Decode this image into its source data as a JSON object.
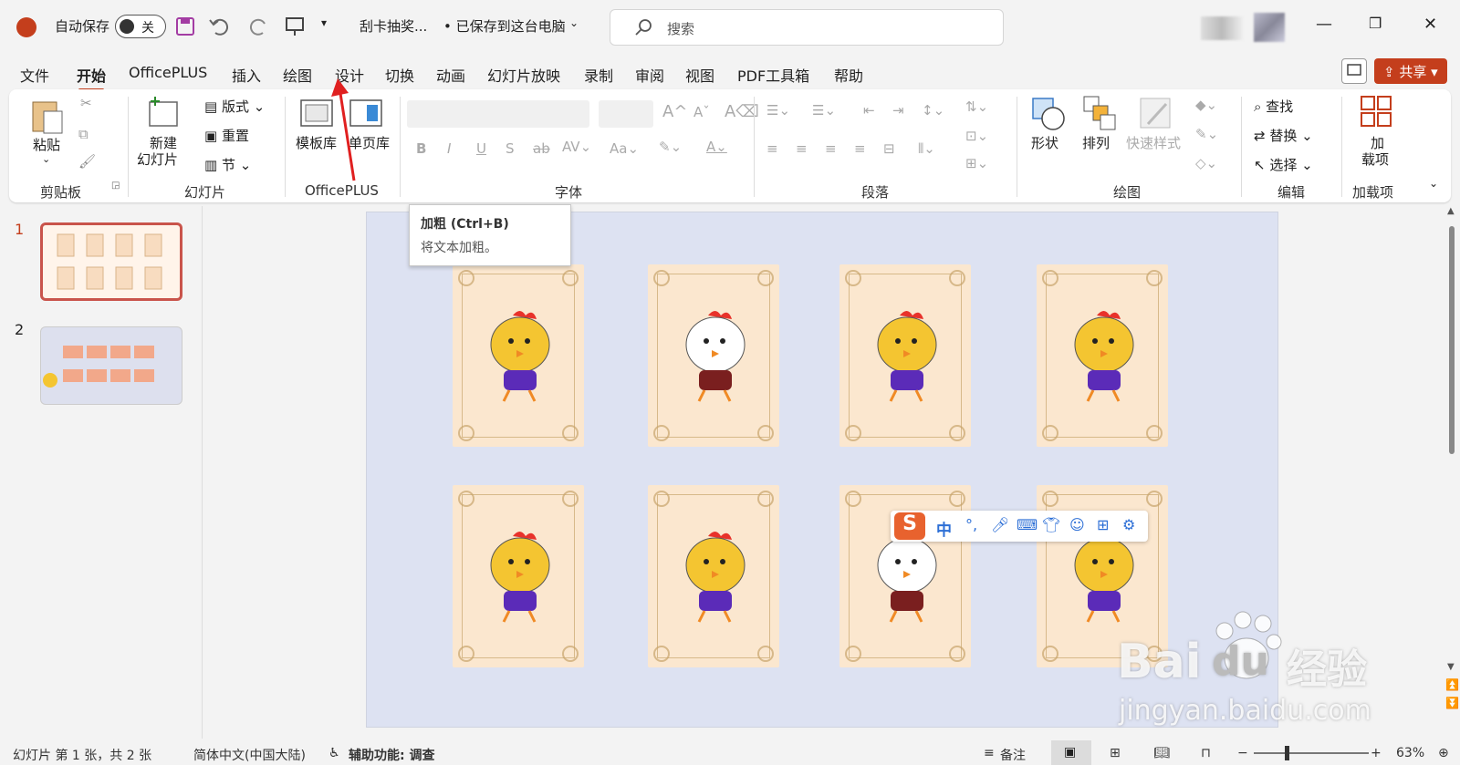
{
  "titlebar": {
    "autosave_label": "自动保存",
    "toggle_label": "关",
    "doc_name": "刮卡抽奖...",
    "save_status": "• 已保存到这台电脑",
    "search_placeholder": "搜索"
  },
  "tabs": [
    "文件",
    "开始",
    "OfficePLUS",
    "插入",
    "绘图",
    "设计",
    "切换",
    "动画",
    "幻灯片放映",
    "录制",
    "审阅",
    "视图",
    "PDF工具箱",
    "帮助"
  ],
  "share_label": "共享",
  "ribbon": {
    "clipboard": {
      "paste": "粘贴",
      "group": "剪贴板"
    },
    "slides": {
      "new_slide_1": "新建",
      "new_slide_2": "幻灯片",
      "layout": "版式",
      "reset": "重置",
      "section": "节",
      "group": "幻灯片"
    },
    "officeplus": {
      "template": "模板库",
      "single_page": "单页库",
      "group": "OfficePLUS"
    },
    "font": {
      "group": "字体"
    },
    "paragraph": {
      "group": "段落"
    },
    "drawing": {
      "shape": "形状",
      "arrange": "排列",
      "quick_style": "快速样式",
      "group": "绘图"
    },
    "editing": {
      "find": "查找",
      "replace": "替换",
      "select": "选择",
      "group": "编辑"
    },
    "addins": {
      "add_1": "加",
      "add_2": "载项",
      "group": "加载项"
    }
  },
  "tooltip": {
    "title": "加粗 (Ctrl+B)",
    "desc": "将文本加粗。"
  },
  "slides": [
    {
      "number": "1"
    },
    {
      "number": "2"
    }
  ],
  "ime_toolbar": {
    "mode": "中"
  },
  "status": {
    "slide_info": "幻灯片 第 1 张，共 2 张",
    "language": "简体中文(中国大陆)",
    "accessibility": "辅助功能: 调查",
    "notes": "备注",
    "zoom": "63%"
  },
  "watermark": {
    "logo": "Bai",
    "logo2": "du",
    "cn": "经验",
    "url": "jingyan.baidu.com"
  },
  "colors": {
    "accent": "#c43e1c",
    "slide_bg": "#dde2f2",
    "card": "#fbe7cf"
  }
}
